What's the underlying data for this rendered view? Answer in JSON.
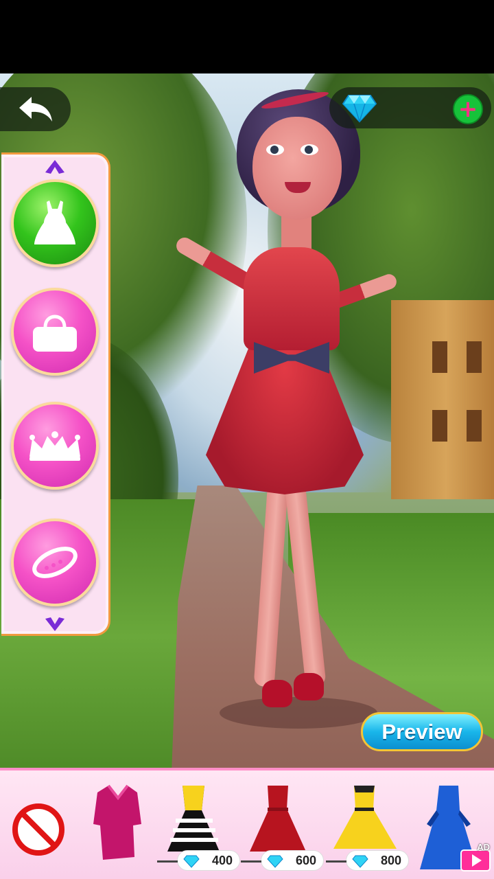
{
  "header": {
    "back_icon": "back-arrow-icon",
    "gem_icon": "diamond-icon",
    "gem_count": "",
    "add_icon": "plus-icon",
    "add_symbol": "+"
  },
  "sidebar": {
    "up_icon": "chevron-up-icon",
    "down_icon": "chevron-down-icon",
    "categories": [
      {
        "icon": "dress-icon",
        "selected": true
      },
      {
        "icon": "handbag-icon",
        "selected": false
      },
      {
        "icon": "crown-icon",
        "selected": false
      },
      {
        "icon": "bracelet-icon",
        "selected": false
      }
    ]
  },
  "preview": {
    "label": "Preview"
  },
  "tray": {
    "none_icon": "no-item-icon",
    "items": [
      {
        "name": "magenta-coat-dress",
        "price": null
      },
      {
        "name": "yellow-striped-dress",
        "price": "400"
      },
      {
        "name": "red-lace-dress",
        "price": "600"
      },
      {
        "name": "yellow-flare-dress",
        "price": "800"
      },
      {
        "name": "blue-gown",
        "price": null,
        "ad_label": "AD"
      }
    ]
  },
  "colors": {
    "accent_pink": "#f552c7",
    "selected_green": "#33c41c",
    "preview_blue": "#19b6ea",
    "tray_bg": "#fad0ea"
  }
}
